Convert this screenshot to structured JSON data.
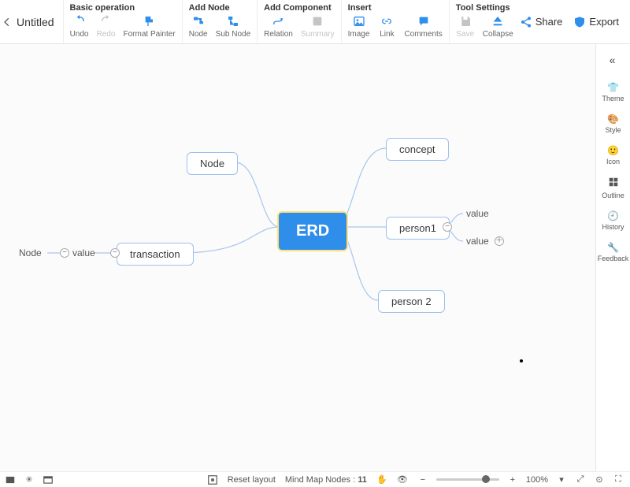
{
  "title": "Untitled",
  "toolbar": {
    "basic": {
      "title": "Basic operation",
      "undo": "Undo",
      "redo": "Redo",
      "format_painter": "Format Painter"
    },
    "addnode": {
      "title": "Add Node",
      "node": "Node",
      "subnode": "Sub Node"
    },
    "addcomp": {
      "title": "Add Component",
      "relation": "Relation",
      "summary": "Summary"
    },
    "insert": {
      "title": "Insert",
      "image": "Image",
      "link": "Link",
      "comments": "Comments"
    },
    "tools": {
      "title": "Tool Settings",
      "save": "Save",
      "collapse": "Collapse"
    },
    "share": "Share",
    "export": "Export"
  },
  "sidebar": {
    "theme": "Theme",
    "style": "Style",
    "icon": "Icon",
    "outline": "Outline",
    "history": "History",
    "feedback": "Feedback"
  },
  "nodes": {
    "center": "ERD",
    "node_top": "Node",
    "transaction": "transaction",
    "left_node": "Node",
    "left_value": "value",
    "concept": "concept",
    "person1": "person1",
    "p1_val1": "value",
    "p1_val2": "value",
    "person2": "person 2"
  },
  "bottom": {
    "reset": "Reset layout",
    "nodes_label": "Mind Map Nodes :",
    "nodes_count": "11",
    "zoom": "100%"
  }
}
